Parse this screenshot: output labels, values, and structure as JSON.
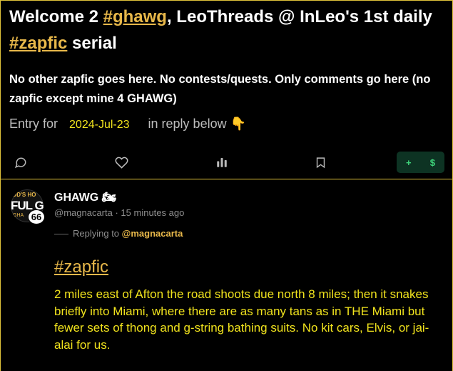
{
  "post": {
    "title_part1": "Welcome 2 ",
    "title_tag1": "#ghawg",
    "title_part2": ", LeoThreads @ InLeo's 1st daily ",
    "title_tag2": "#zapfic",
    "title_part3": " serial",
    "subtitle": "No other zapfic goes here. No contests/quests. Only comments go here (no zapfic except mine 4 GHAWG)",
    "entry_label": "Entry for",
    "entry_date": "2024-Jul-23",
    "entry_suffix": "in reply below",
    "entry_emoji": "👇",
    "actions": {
      "comment_icon": "comment-icon",
      "like_icon": "heart-icon",
      "stats_icon": "stats-icon",
      "bookmark_icon": "bookmark-icon",
      "tip_plus": "+",
      "tip_dollar": "$"
    }
  },
  "reply": {
    "avatar_text_top": "OD'S HO",
    "avatar_text_mid": "FUL G",
    "avatar_text_bottom": "GHA",
    "reputation": "66",
    "username": "GHAWG",
    "username_emoji": "🏍",
    "handle": "@magnacarta",
    "time": "15 minutes ago",
    "replying_label": "Replying to",
    "replying_mention": "@magnacarta",
    "hashtag": "#zapfic",
    "body": "2 miles east of Afton the road shoots due north 8 miles; then it snakes briefly into Miami, where there are as many tans as in THE Miami but fewer sets of thong and g-string bathing suits. No kit cars, Elvis, or jai-alai for us."
  },
  "colors": {
    "accent": "#e8b84a",
    "body_text": "#f1e31d",
    "border": "#e0c33a",
    "tip_bg": "#0d3323",
    "tip_fg": "#3ed37a"
  }
}
